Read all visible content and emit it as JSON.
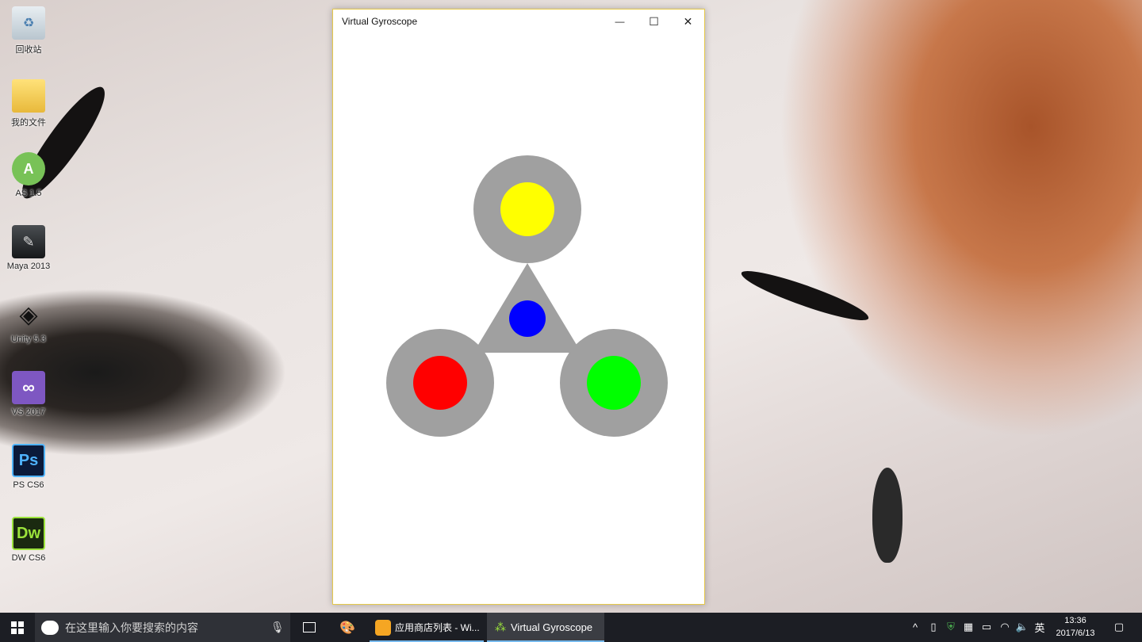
{
  "desktop": {
    "icons": [
      {
        "label": "回收站",
        "icon": "recycle-bin-icon"
      },
      {
        "label": "我的文件",
        "icon": "folder-icon"
      },
      {
        "label": "AS 1.5",
        "icon": "android-studio-icon"
      },
      {
        "label": "Maya 2013",
        "icon": "maya-icon"
      },
      {
        "label": "Unity 5.3",
        "icon": "unity-icon"
      },
      {
        "label": "VS 2017",
        "icon": "visual-studio-icon"
      },
      {
        "label": "PS CS6",
        "icon": "photoshop-icon",
        "glyph": "Ps"
      },
      {
        "label": "DW CS6",
        "icon": "dreamweaver-icon",
        "glyph": "Dw"
      }
    ]
  },
  "window": {
    "title": "Virtual Gyroscope",
    "minimize_glyph": "—",
    "maximize_glyph": "☐",
    "close_glyph": "✕"
  },
  "spinner": {
    "frame_color": "#a0a0a0",
    "top_dot_color": "#ffff00",
    "center_dot_color": "#0000ff",
    "left_dot_color": "#ff0000",
    "right_dot_color": "#00ff00"
  },
  "taskbar": {
    "search_placeholder": "在这里输入你要搜索的内容",
    "apps": [
      {
        "label": "应用商店列表 - Wi...",
        "icon": "store-icon"
      },
      {
        "label": "Virtual Gyroscope",
        "icon": "gyroscope-app-icon",
        "active": true
      }
    ],
    "ime_label": "英",
    "time": "13:36",
    "date": "2017/6/13"
  }
}
